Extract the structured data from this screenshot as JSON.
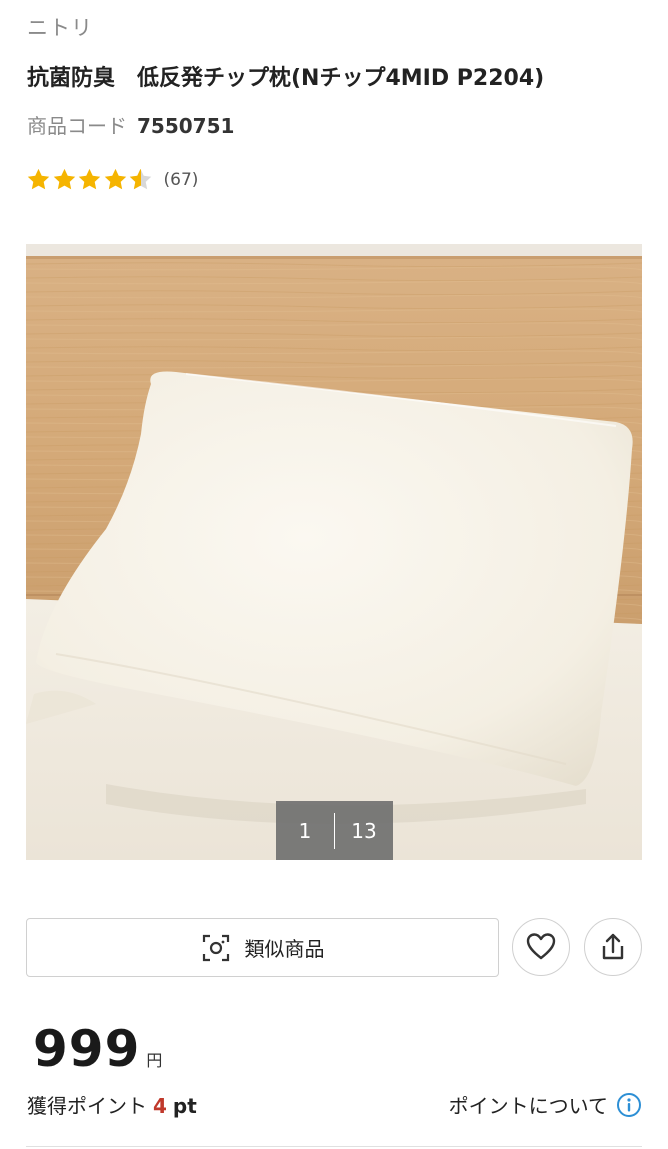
{
  "brand": "ニトリ",
  "product": {
    "title": "抗菌防臭　低反発チップ枕(Nチップ4MID P2204)",
    "code_label": "商品コード",
    "code_value": "7550751"
  },
  "rating": {
    "stars": 4.5,
    "count_text": "(67)",
    "star_color": "#f5b400",
    "empty_star_color": "#d8d8d8"
  },
  "gallery": {
    "current": "1",
    "total": "13"
  },
  "actions": {
    "similar_label": "類似商品",
    "favorite_icon": "heart-icon",
    "share_icon": "share-icon"
  },
  "price": {
    "value": "999",
    "currency": "円"
  },
  "points": {
    "label": "獲得ポイント",
    "value": "4",
    "unit": "pt",
    "about_label": "ポイントについて",
    "value_color": "#c0392b",
    "info_color": "#2d8fd5"
  }
}
